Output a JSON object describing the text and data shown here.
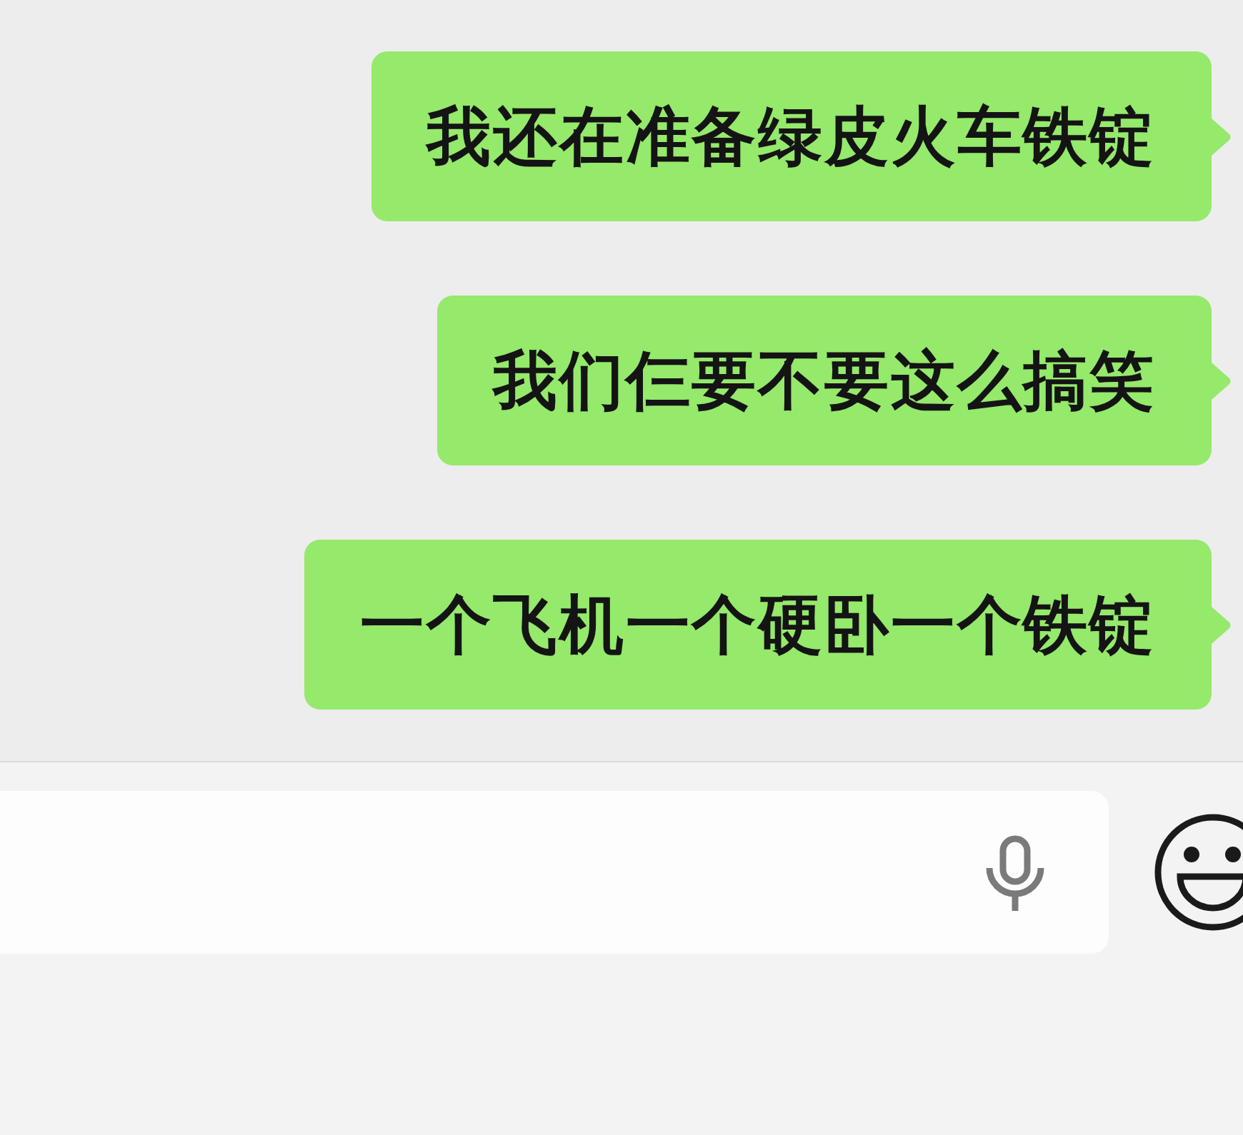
{
  "messages": [
    {
      "text": "我还在准备绿皮火车铁锭"
    },
    {
      "text": "我们仨要不要这么搞笑"
    },
    {
      "text": "一个飞机一个硬卧一个铁锭"
    }
  ]
}
